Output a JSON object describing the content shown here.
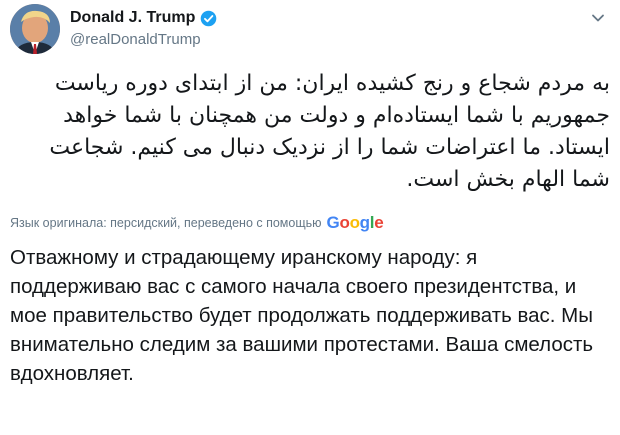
{
  "tweet": {
    "author": {
      "display_name": "Donald J. Trump",
      "handle": "@realDonaldTrump",
      "verified": true,
      "avatar_icon": "profile-photo"
    },
    "menu_icon": "chevron-down-icon",
    "original_text": "به مردم شجاع و رنج کشیده ایران: من از ابتدای دوره ریاست جمهوریم با شما ایستاده‌ام و دولت من همچنان با شما خواهد ایستاد. ما اعتراضات شما را از نزدیک دنبال می کنیم. شجاعت شما الهام بخش است.",
    "translation_note": "Язык оригинала: персидский, переведено с помощью",
    "translation_provider": {
      "letters": [
        "G",
        "o",
        "o",
        "g",
        "l",
        "e"
      ],
      "colors": [
        "#4285f4",
        "#ea4335",
        "#fbbc05",
        "#4285f4",
        "#34a853",
        "#ea4335"
      ]
    },
    "translated_text": "Отважному и страдающему иранскому народу: я поддерживаю вас с самого начала своего президентства, и мое правительство будет продолжать поддерживать вас. Мы внимательно следим за вашими протестами. Ваша смелость вдохновляет."
  },
  "colors": {
    "text_primary": "#14171a",
    "text_secondary": "#657786",
    "verified_blue": "#1da1f2"
  }
}
